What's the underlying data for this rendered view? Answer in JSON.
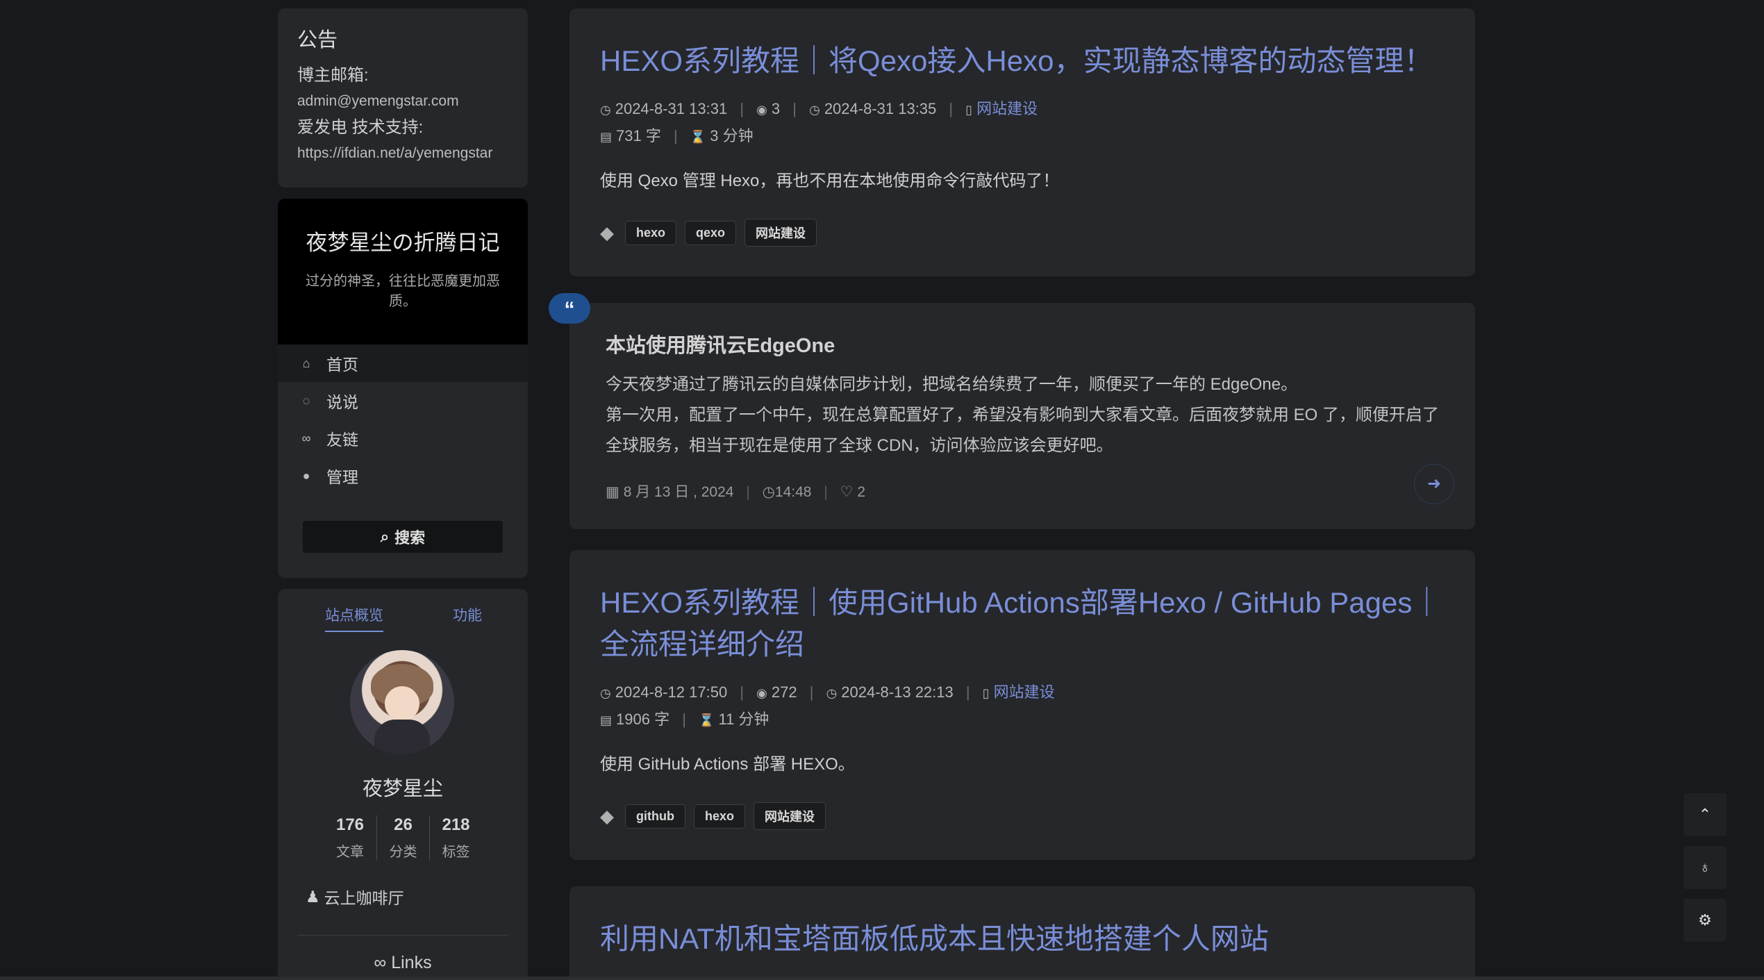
{
  "notice": {
    "title": "公告",
    "email_label": "博主邮箱:",
    "email": "admin@yemengstar.com",
    "support_label": "爱发电 技术支持:",
    "support_url": "https://ifdian.net/a/yemengstar"
  },
  "brand": {
    "site_title": "夜梦星尘の折腾日记",
    "subtitle": "过分的神圣，往往比恶魔更加恶质。"
  },
  "menu": {
    "items": [
      {
        "label": "首页",
        "icon": "home-icon"
      },
      {
        "label": "说说",
        "icon": "comment-icon"
      },
      {
        "label": "友链",
        "icon": "link-icon"
      },
      {
        "label": "管理",
        "icon": "user-icon"
      }
    ],
    "search_label": "搜索"
  },
  "profile": {
    "tab_overview": "站点概览",
    "tab_functions": "功能",
    "name": "夜梦星尘",
    "stats": [
      {
        "value": "176",
        "label": "文章"
      },
      {
        "value": "26",
        "label": "分类"
      },
      {
        "value": "218",
        "label": "标签"
      }
    ],
    "group": "云上咖啡厅",
    "links": "Links"
  },
  "posts": [
    {
      "title": "HEXO系列教程｜将Qexo接入Hexo，实现静态博客的动态管理！",
      "created": "2024-8-31 13:31",
      "views": "3",
      "updated": "2024-8-31 13:35",
      "category": "网站建设",
      "words": "731 字",
      "read_time": "3 分钟",
      "excerpt": "使用 Qexo 管理 Hexo，再也不用在本地使用命令行敲代码了！",
      "tags": [
        "hexo",
        "qexo",
        "网站建设"
      ]
    },
    {
      "title": "HEXO系列教程｜使用GitHub Actions部署Hexo / GitHub Pages｜全流程详细介绍",
      "created": "2024-8-12 17:50",
      "views": "272",
      "updated": "2024-8-13 22:13",
      "category": "网站建设",
      "words": "1906 字",
      "read_time": "11 分钟",
      "excerpt": "使用 GitHub Actions 部署 HEXO。",
      "tags": [
        "github",
        "hexo",
        "网站建设"
      ]
    },
    {
      "title": "利用NAT机和宝塔面板低成本且快速地搭建个人网站"
    }
  ],
  "talk": {
    "badge": "“",
    "title": "本站使用腾讯云EdgeOne",
    "lines": [
      "今天夜梦通过了腾讯云的自媒体同步计划，把域名给续费了一年，顺便买了一年的 EdgeOne。",
      "第一次用，配置了一个中午，现在总算配置好了，希望没有影响到大家看文章。后面夜梦就用 EO 了，顺便开启了",
      "全球服务，相当于现在是使用了全球 CDN，访问体验应该会更好吧。"
    ],
    "date": "8 月 13 日 , 2024",
    "time": "14:48",
    "likes": "2"
  },
  "colors": {
    "accent": "#7a8ed8",
    "background": "#18191c",
    "card": "#25272a",
    "badge": "#1f4f8f"
  }
}
